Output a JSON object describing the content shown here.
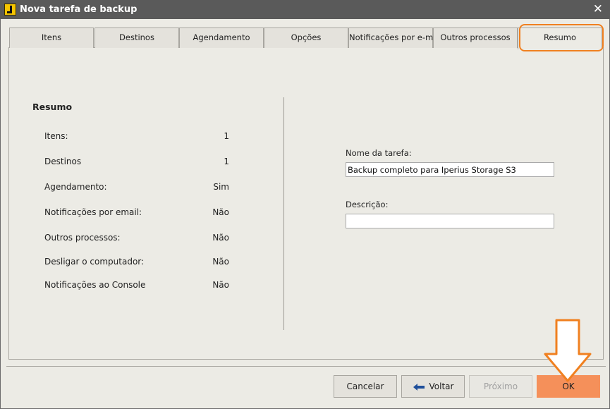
{
  "window": {
    "title": "Nova tarefa de backup",
    "close_glyph": "✕"
  },
  "tabs": [
    {
      "label": "Itens"
    },
    {
      "label": "Destinos"
    },
    {
      "label": "Agendamento"
    },
    {
      "label": "Opções"
    },
    {
      "label": "Notificações por e-mail"
    },
    {
      "label": "Outros processos"
    },
    {
      "label": "Resumo"
    }
  ],
  "active_tab": "Resumo",
  "summary": {
    "title": "Resumo",
    "rows": [
      {
        "label": "Itens:",
        "value": "1"
      },
      {
        "label": "Destinos",
        "value": "1"
      },
      {
        "label": "Agendamento:",
        "value": "Sim"
      },
      {
        "label": "Notificações por email:",
        "value": "Não"
      },
      {
        "label": "Outros processos:",
        "value": "Não"
      },
      {
        "label": "Desligar o computador:",
        "value": "Não"
      },
      {
        "label": "Notificações ao Console",
        "value": "Não"
      }
    ]
  },
  "form": {
    "task_name_label": "Nome da tarefa:",
    "task_name_value": "Backup completo para Iperius Storage S3",
    "description_label": "Descrição:",
    "description_value": ""
  },
  "buttons": {
    "cancel": "Cancelar",
    "back": "Voltar",
    "next": "Próximo",
    "ok": "OK"
  },
  "colors": {
    "accent_orange": "#f08020",
    "ok_button": "#f5905a",
    "titlebar": "#5a5a5a"
  },
  "icons": {
    "app": "iperius-app-icon",
    "close": "close-icon",
    "back": "arrow-left-icon",
    "pointer": "arrow-down-icon"
  }
}
